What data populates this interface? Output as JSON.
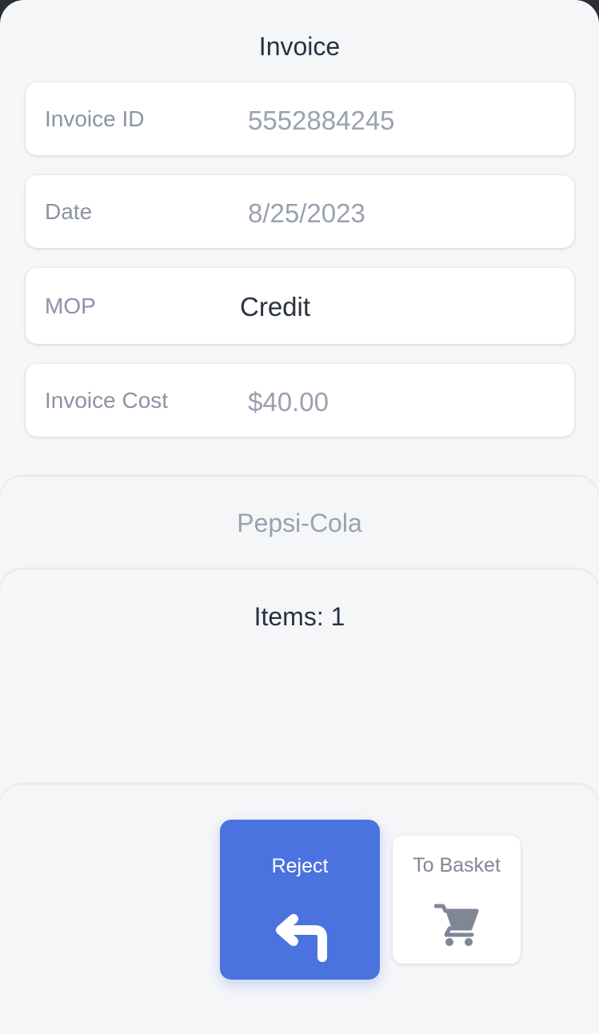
{
  "invoice": {
    "title": "Invoice",
    "fields": [
      {
        "label": "Invoice ID",
        "value": "5552884245"
      },
      {
        "label": "Date",
        "value": "8/25/2023"
      },
      {
        "label": "MOP",
        "value": "Credit"
      },
      {
        "label": "Invoice Cost",
        "value": "$40.00"
      }
    ]
  },
  "vendor": {
    "name": "Pepsi-Cola"
  },
  "items": {
    "summary": "Items: 1"
  },
  "actions": {
    "reject_label": "Reject",
    "reject_icon": "return-arrow-icon",
    "basket_label": "To Basket",
    "basket_icon": "cart-icon"
  },
  "colors": {
    "primary": "#4a73e0",
    "background": "#f5f6f8",
    "card": "#ffffff",
    "muted_text": "#8b93a3",
    "dark_text": "#2a3140"
  }
}
